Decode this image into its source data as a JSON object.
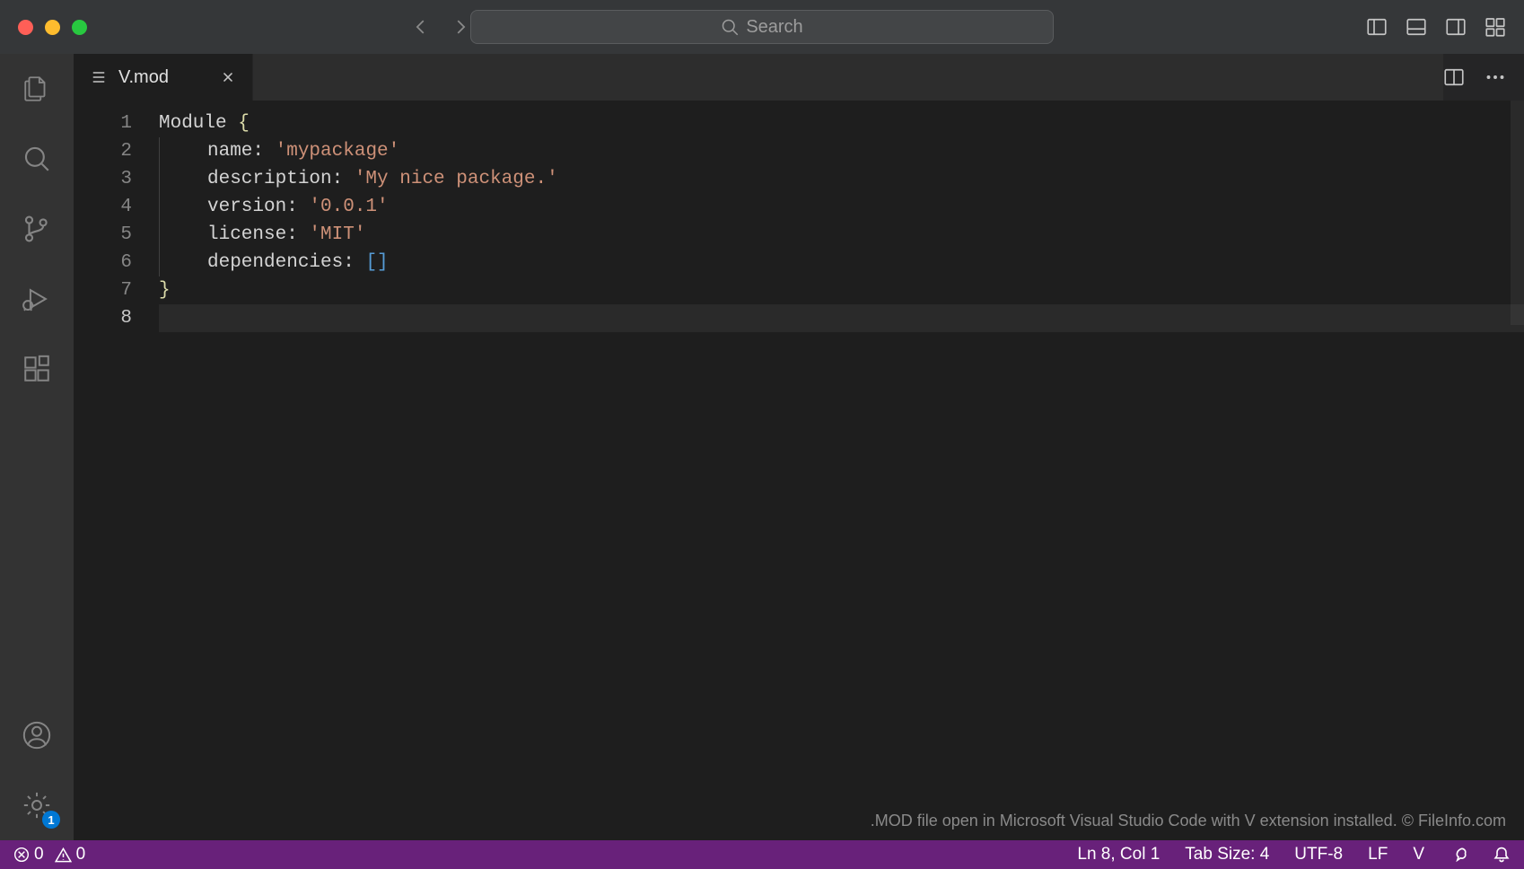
{
  "titlebar": {
    "search_placeholder": "Search"
  },
  "tab": {
    "filename": "V.mod"
  },
  "activity": {
    "settings_badge": "1"
  },
  "editor": {
    "lines": [
      "1",
      "2",
      "3",
      "4",
      "5",
      "6",
      "7",
      "8"
    ],
    "active_line": 8,
    "code": {
      "module_kw": "Module ",
      "brace_open": "{",
      "name_key": "name: ",
      "name_val": "'mypackage'",
      "desc_key": "description: ",
      "desc_val": "'My nice package.'",
      "ver_key": "version: ",
      "ver_val": "'0.0.1'",
      "lic_key": "license: ",
      "lic_val": "'MIT'",
      "dep_key": "dependencies: ",
      "dep_val": "[]",
      "brace_close": "}"
    }
  },
  "watermark": ".MOD file open in Microsoft Visual Studio Code with V extension installed. © FileInfo.com",
  "status": {
    "errors": "0",
    "warnings": "0",
    "position": "Ln 8, Col 1",
    "tab_size": "Tab Size: 4",
    "encoding": "UTF-8",
    "eol": "LF",
    "language": "V"
  }
}
